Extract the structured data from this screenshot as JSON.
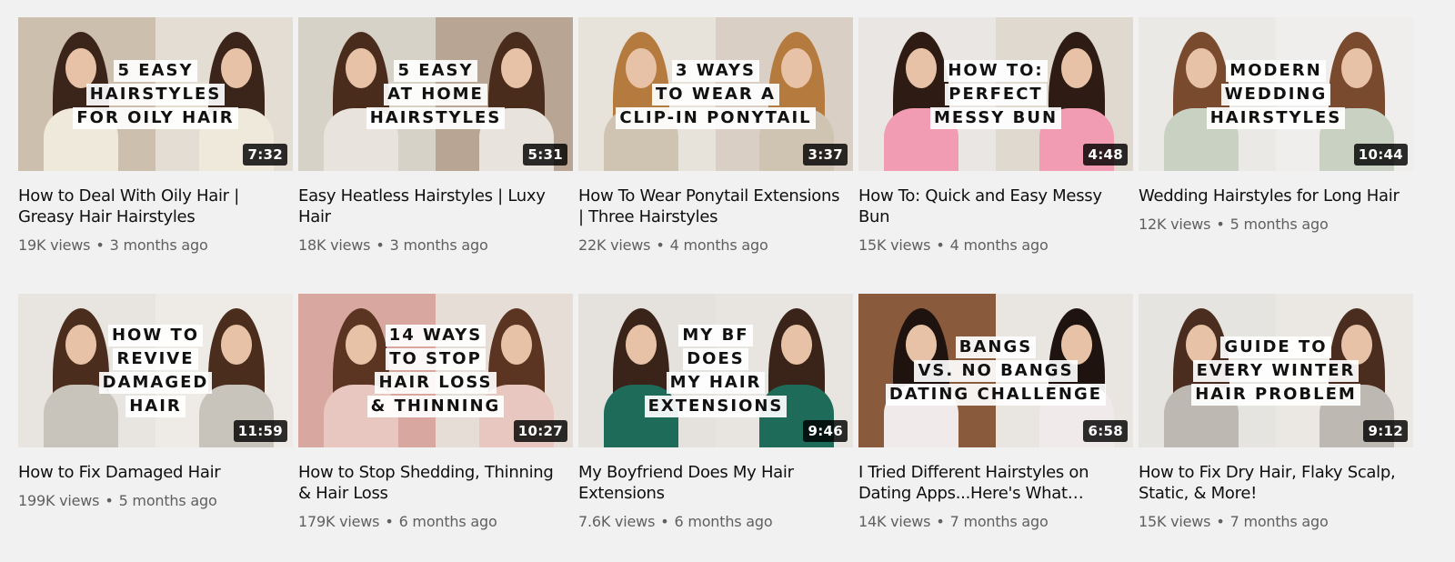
{
  "videos": [
    {
      "thumb_text": [
        "5 EASY",
        "HAIRSTYLES",
        "FOR OILY HAIR"
      ],
      "duration": "7:32",
      "title": "How to Deal With Oily Hair | Greasy Hair Hairstyles",
      "views": "19K views",
      "age": "3 months ago",
      "colors": {
        "left": "#cdbfae",
        "right": "#e3ddd4",
        "hair": "#3b2419",
        "shirt": "#efe9dc"
      }
    },
    {
      "thumb_text": [
        "5 EASY",
        "AT HOME",
        "HAIRSTYLES"
      ],
      "duration": "5:31",
      "title": "Easy Heatless Hairstyles | Luxy Hair",
      "views": "18K views",
      "age": "3 months ago",
      "colors": {
        "left": "#d7d2c8",
        "right": "#b8a593",
        "hair": "#4a2c1c",
        "shirt": "#e8e3dc"
      }
    },
    {
      "thumb_text": [
        "3 WAYS",
        "TO WEAR A",
        "CLIP-IN PONYTAIL"
      ],
      "duration": "3:37",
      "title": "How To Wear Ponytail Extensions | Three Hairstyles",
      "views": "22K views",
      "age": "4 months ago",
      "colors": {
        "left": "#e7e2da",
        "right": "#d9cfc4",
        "hair": "#b57a3e",
        "shirt": "#cfc3b1"
      }
    },
    {
      "thumb_text": [
        "HOW TO:",
        "PERFECT",
        "MESSY BUN"
      ],
      "duration": "4:48",
      "title": "How To: Quick and Easy Messy Bun",
      "views": "15K views",
      "age": "4 months ago",
      "colors": {
        "left": "#e9e6e3",
        "right": "#e0d9d0",
        "hair": "#2e1c14",
        "shirt": "#f29cb3"
      }
    },
    {
      "thumb_text": [
        "MODERN",
        "WEDDING",
        "HAIRSTYLES"
      ],
      "duration": "10:44",
      "title": "Wedding Hairstyles for Long Hair",
      "views": "12K views",
      "age": "5 months ago",
      "colors": {
        "left": "#ebe9e6",
        "right": "#f0eeec",
        "hair": "#7a4a2e",
        "shirt": "#c9d2c2"
      }
    },
    {
      "thumb_text": [
        "HOW TO",
        "REVIVE",
        "DAMAGED",
        "HAIR"
      ],
      "duration": "11:59",
      "title": "How to Fix Damaged Hair",
      "views": "199K views",
      "age": "5 months ago",
      "colors": {
        "left": "#e8e5e0",
        "right": "#eeebe7",
        "hair": "#4b2d1d",
        "shirt": "#c8c3bb"
      }
    },
    {
      "thumb_text": [
        "14 WAYS",
        "TO STOP",
        "HAIR LOSS",
        "& THINNING"
      ],
      "duration": "10:27",
      "title": "How to Stop Shedding, Thinning & Hair Loss",
      "views": "179K views",
      "age": "6 months ago",
      "colors": {
        "left": "#d8a7a0",
        "right": "#e6ded6",
        "hair": "#5b3422",
        "shirt": "#e8c7c0"
      }
    },
    {
      "thumb_text": [
        "MY BF",
        "DOES",
        "MY HAIR",
        "EXTENSIONS"
      ],
      "duration": "9:46",
      "title": "My Boyfriend Does My Hair Extensions",
      "views": "7.6K views",
      "age": "6 months ago",
      "colors": {
        "left": "#e5e2de",
        "right": "#e8e5e1",
        "hair": "#3a2318",
        "shirt": "#1f6b5a"
      }
    },
    {
      "thumb_text": [
        "BANGS",
        "VS. NO BANGS",
        "DATING CHALLENGE"
      ],
      "duration": "6:58",
      "title": "I Tried Different Hairstyles on Dating Apps...Here's What Happened",
      "views": "14K views",
      "age": "7 months ago",
      "colors": {
        "left": "#8a5a3c",
        "right": "#e9e6e2",
        "hair": "#1e130e",
        "shirt": "#f0eaea"
      }
    },
    {
      "thumb_text": [
        "GUIDE TO",
        "EVERY WINTER",
        "HAIR PROBLEM"
      ],
      "duration": "9:12",
      "title": "How to Fix Dry Hair, Flaky Scalp, Static, & More!",
      "views": "15K views",
      "age": "7 months ago",
      "colors": {
        "left": "#e6e4e0",
        "right": "#ebe8e4",
        "hair": "#4a2d1e",
        "shirt": "#bdb8b1"
      }
    }
  ]
}
